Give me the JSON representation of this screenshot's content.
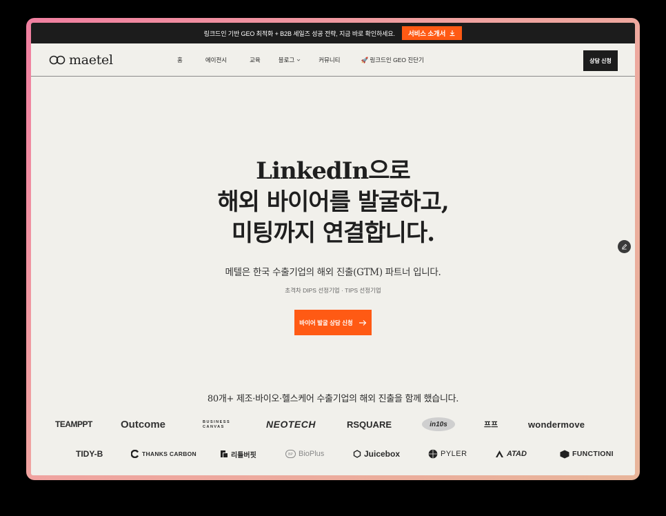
{
  "announcement": {
    "text": "링크드인 기반 GEO 최적화 + B2B 세일즈 성공 전략, 지금 바로 확인하세요.",
    "cta_label": "서비스 소개서",
    "cta_icon": "download-icon"
  },
  "nav": {
    "logo_text": "maetel",
    "items": [
      {
        "label": "홈"
      },
      {
        "label": "에이전시"
      },
      {
        "label": "교육"
      },
      {
        "label": "블로그"
      },
      {
        "label": "커뮤니티"
      },
      {
        "label": "🚀 링크드인 GEO 진단기"
      }
    ],
    "consult_label": "상담 신청"
  },
  "hero": {
    "line1": "LinkedIn으로",
    "line2": "해외 바이어를 발굴하고,",
    "line3": "미팅까지 연결합니다.",
    "subtitle": "메텔은 한국 수출기업의 해외 진출(GTM) 파트너 입니다.",
    "small": "초격차 DIPS 선정기업 · TIPS 선정기업",
    "cta_label": "바이어 발굴 상담 신청"
  },
  "clients": {
    "title": "80개+ 제조·바이오·헬스케어 수출기업의 해외 진출을 함께 했습니다.",
    "row1": [
      "TEAMPPT",
      "Outcome",
      "BUSINESS",
      "CANVAS",
      "NEOTECH",
      "RSQUARE",
      "in10s",
      "프프",
      "wondermove"
    ],
    "row2": [
      "TIDY-B",
      "THANKS CARBON",
      "리틀버핏",
      "BioPlus",
      "Juicebox",
      "PYLER",
      "ATAD",
      "FUNCTIONI"
    ]
  },
  "colors": {
    "accent": "#ff5a14",
    "dark": "#1c1c1c",
    "background": "#f1f0eb",
    "frame_gradient": [
      "#f07fa0",
      "#e8b59a"
    ]
  }
}
